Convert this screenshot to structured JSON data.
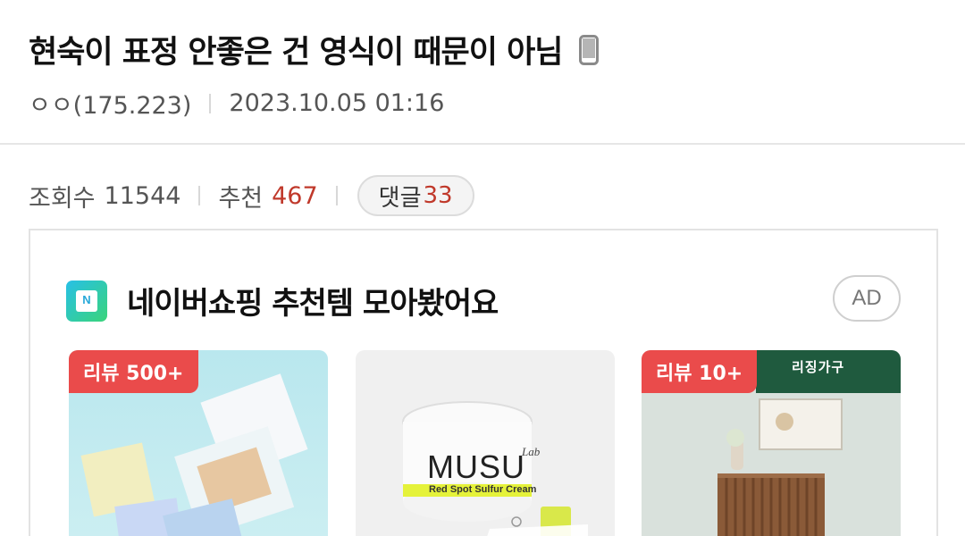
{
  "post": {
    "title": "현숙이 표정 안좋은 건 영식이 때문이 아님",
    "author": "ㅇㅇ(175.223)",
    "datetime": "2023.10.05 01:16"
  },
  "stats": {
    "views_label": "조회수",
    "views_value": "11544",
    "recommend_label": "추천",
    "recommend_value": "467",
    "comments_label": "댓글",
    "comments_value": "33"
  },
  "ad": {
    "title": "네이버쇼핑 추천템 모아봤어요",
    "badge": "AD",
    "products": [
      {
        "badge": "리뷰 500+"
      },
      {
        "badge": "",
        "brand": "MUSU",
        "brand_sub": "Lab",
        "product_name": "Red Spot Sulfur Cream"
      },
      {
        "badge": "리뷰 10+",
        "brand": "리징가구"
      }
    ]
  },
  "colors": {
    "accent_red": "#c0392b",
    "badge_red": "#ea4b4b"
  },
  "icons": {
    "device": "mobile-phone-icon",
    "shop": "naver-shopping-icon"
  }
}
